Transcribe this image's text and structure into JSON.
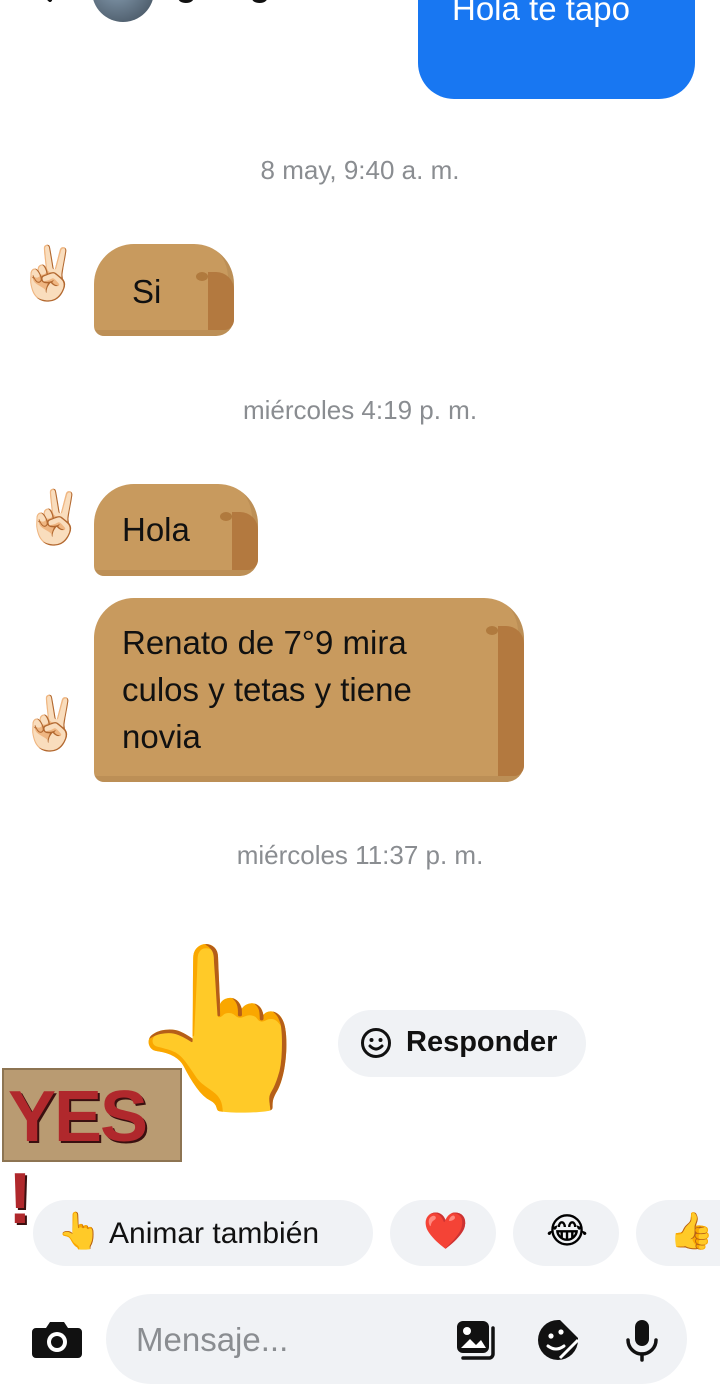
{
  "header": {
    "name": "georgian"
  },
  "outgoing": {
    "text": "Hola te tapo"
  },
  "timestamps": [
    "8 may, 9:40 a. m.",
    "miércoles 4:19 p. m.",
    "miércoles 11:37 p. m."
  ],
  "messages": [
    {
      "text": "Si"
    },
    {
      "text": "Hola"
    },
    {
      "lines": [
        "Renato de 7°9 mira",
        "culos y tetas y tiene",
        "novia"
      ]
    }
  ],
  "sticker": {
    "yes_text": "YES !"
  },
  "reply": {
    "label": "Responder",
    "icon": "smile-icon"
  },
  "reactions": [
    {
      "emoji": "👆",
      "label": "Animar también"
    },
    {
      "emoji": "❤️",
      "label": ""
    },
    {
      "emoji": "😂",
      "label": ""
    },
    {
      "emoji": "👍",
      "label": ""
    }
  ],
  "composer": {
    "placeholder": "Mensaje..."
  },
  "colors": {
    "accent": "#1877f2",
    "bubble": "#c89a5e",
    "pill": "#f0f2f5",
    "timestamp": "#8a8d91"
  }
}
